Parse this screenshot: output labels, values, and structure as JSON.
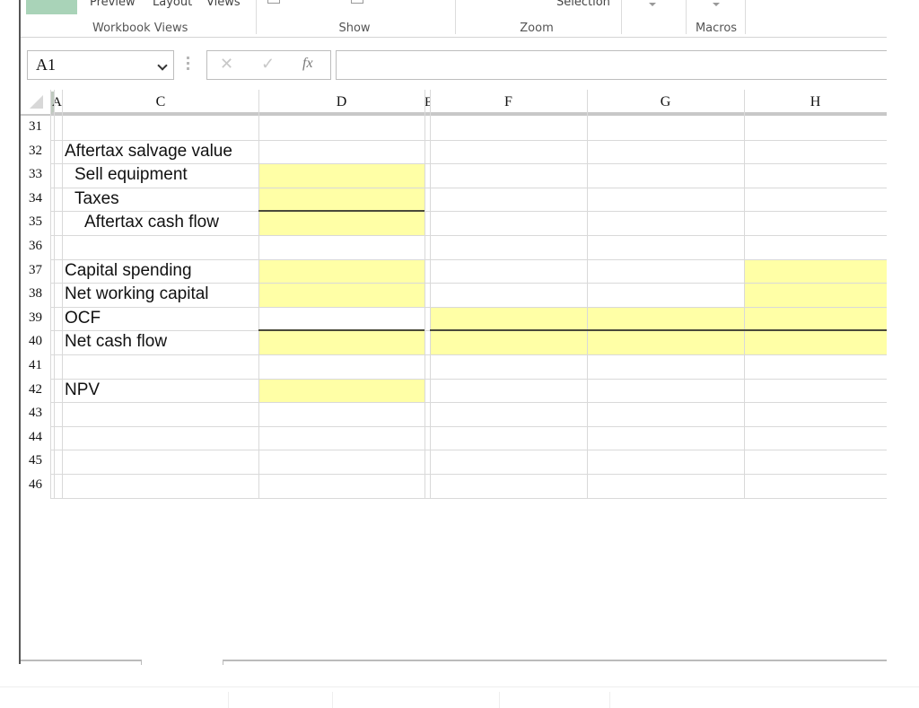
{
  "ribbon": {
    "workbook_views": {
      "items": [
        "Preview",
        "Layout",
        "Views"
      ],
      "label": "Workbook Views"
    },
    "show": {
      "label": "Show"
    },
    "zoom": {
      "partial_item": "Selection",
      "label": "Zoom"
    },
    "macros": {
      "label": "Macros"
    }
  },
  "formula_bar": {
    "name_box": "A1",
    "cancel_icon": "✕",
    "enter_icon": "✓",
    "function_label": "fx",
    "formula_value": ""
  },
  "sheet": {
    "columns": [
      "A",
      "B",
      "C",
      "D",
      "E",
      "F",
      "G",
      "H"
    ],
    "column_headers_visible": {
      "ab": "AB",
      "c": "C",
      "d": "D",
      "e": "E",
      "f": "F",
      "g": "G",
      "h": "H"
    },
    "rows": [
      {
        "num": "31",
        "label": ""
      },
      {
        "num": "32",
        "label": "Aftertax salvage value"
      },
      {
        "num": "33",
        "label": "Sell equipment"
      },
      {
        "num": "34",
        "label": "Taxes"
      },
      {
        "num": "35",
        "label": "Aftertax cash flow"
      },
      {
        "num": "36",
        "label": ""
      },
      {
        "num": "37",
        "label": "Capital spending"
      },
      {
        "num": "38",
        "label": "Net working capital"
      },
      {
        "num": "39",
        "label": "OCF"
      },
      {
        "num": "40",
        "label": "Net cash flow"
      },
      {
        "num": "41",
        "label": ""
      },
      {
        "num": "42",
        "label": "NPV"
      },
      {
        "num": "43",
        "label": ""
      },
      {
        "num": "44",
        "label": ""
      },
      {
        "num": "45",
        "label": ""
      },
      {
        "num": "46",
        "label": ""
      }
    ],
    "input_fill_color": "#ffffa6",
    "accent_color": "#217346"
  }
}
